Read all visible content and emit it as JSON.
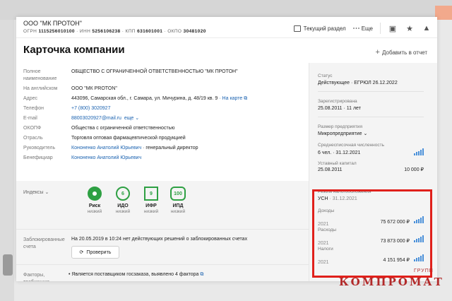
{
  "header": {
    "company_short": "ООО \"МК ПРОТОН\"",
    "ogrn_label": "ОГРН",
    "ogrn": "1115256010100",
    "inn_label": "ИНН",
    "inn": "5256106238",
    "kpp_label": "КПП",
    "kpp": "631601001",
    "okpo_label": "ОКПО",
    "okpo": "30481020",
    "current_section": "Текущий раздел",
    "more": "Еще"
  },
  "title": "Карточка компании",
  "add_to_report": "Добавить в отчет",
  "info": {
    "full_name_label": "Полное наименование",
    "full_name": "ОБЩЕСТВО С ОГРАНИЧЕННОЙ ОТВЕТСТВЕННОСТЬЮ \"МК ПРОТОН\"",
    "english_label": "На английском",
    "english": "ООО \"МК PROTON\"",
    "address_label": "Адрес",
    "address": "443096, Самарская обл., г. Самара, ул. Мичурина, д. 48/19 кв. 9",
    "on_map": "На карте",
    "phone_label": "Телефон",
    "phone": "+7 (800) 3020927",
    "email_label": "E-mail",
    "email": "88003020927@mail.ru",
    "email_more": "еще",
    "okopf_label": "ОКОПФ",
    "okopf": "Общества с ограниченной ответственностью",
    "industry_label": "Отрасль",
    "industry": "Торговля оптовая фармацевтической продукцией",
    "head_label": "Руководитель",
    "head_name": "Кононенко Анатолий Юрьевич",
    "head_role": " · генеральный директор",
    "beneficiary_label": "Бенефициар",
    "beneficiary": "Кононенко Анатолий Юрьевич"
  },
  "indices": {
    "label": "Индексы",
    "items": [
      {
        "name": "Риск",
        "level": "низкий",
        "badge": ""
      },
      {
        "name": "ИДО",
        "level": "низкий",
        "badge": "6"
      },
      {
        "name": "ИФР",
        "level": "низкий",
        "badge": "9"
      },
      {
        "name": "ИПД",
        "level": "низкий",
        "badge": "100"
      }
    ]
  },
  "blocked": {
    "label": "Заблокированные счета",
    "text": "На 20.05.2019 в 10:24 нет действующих решений о заблокированных счетах",
    "check_button": "Проверить"
  },
  "factors": {
    "label": "Факторы, требующие",
    "text": "Является поставщиком госзаказа, выявлено 4 фактора"
  },
  "right": {
    "status_label": "Статус",
    "status_value": "Действующее · ЕГРЮЛ 26.12.2022",
    "registered_label": "Зарегистрирована",
    "registered_value": "25.08.2011 · 11 лет",
    "size_label": "Размер предприятия",
    "size_value": "Микропредприятие",
    "employees_label": "Среднесписочная численность",
    "employees_value": "6 чел. · 31.12.2021",
    "capital_label": "Уставный капитал",
    "capital_date": "25.08.2011",
    "capital_value": "10 000 ₽",
    "tax_label": "Режим налогообложения",
    "tax_value": "УСН",
    "tax_date": " · 31.12.2021",
    "income_label": "Доходы",
    "income_year": "2021",
    "income_value": "75 672 000 ₽",
    "expenses_label": "Расходы",
    "expenses_year": "2021",
    "expenses_value": "73 873 000 ₽",
    "taxes_label": "Налоги",
    "taxes_year": "2021",
    "taxes_value": "4 151 954 ₽"
  },
  "watermark": "КОМПРОМАТ",
  "watermark_sup": "ГРУПП",
  "colors": {
    "accent_red": "#e0201b",
    "green": "#2ea043",
    "link": "#1a62b0",
    "bars": "#4a90d9"
  }
}
